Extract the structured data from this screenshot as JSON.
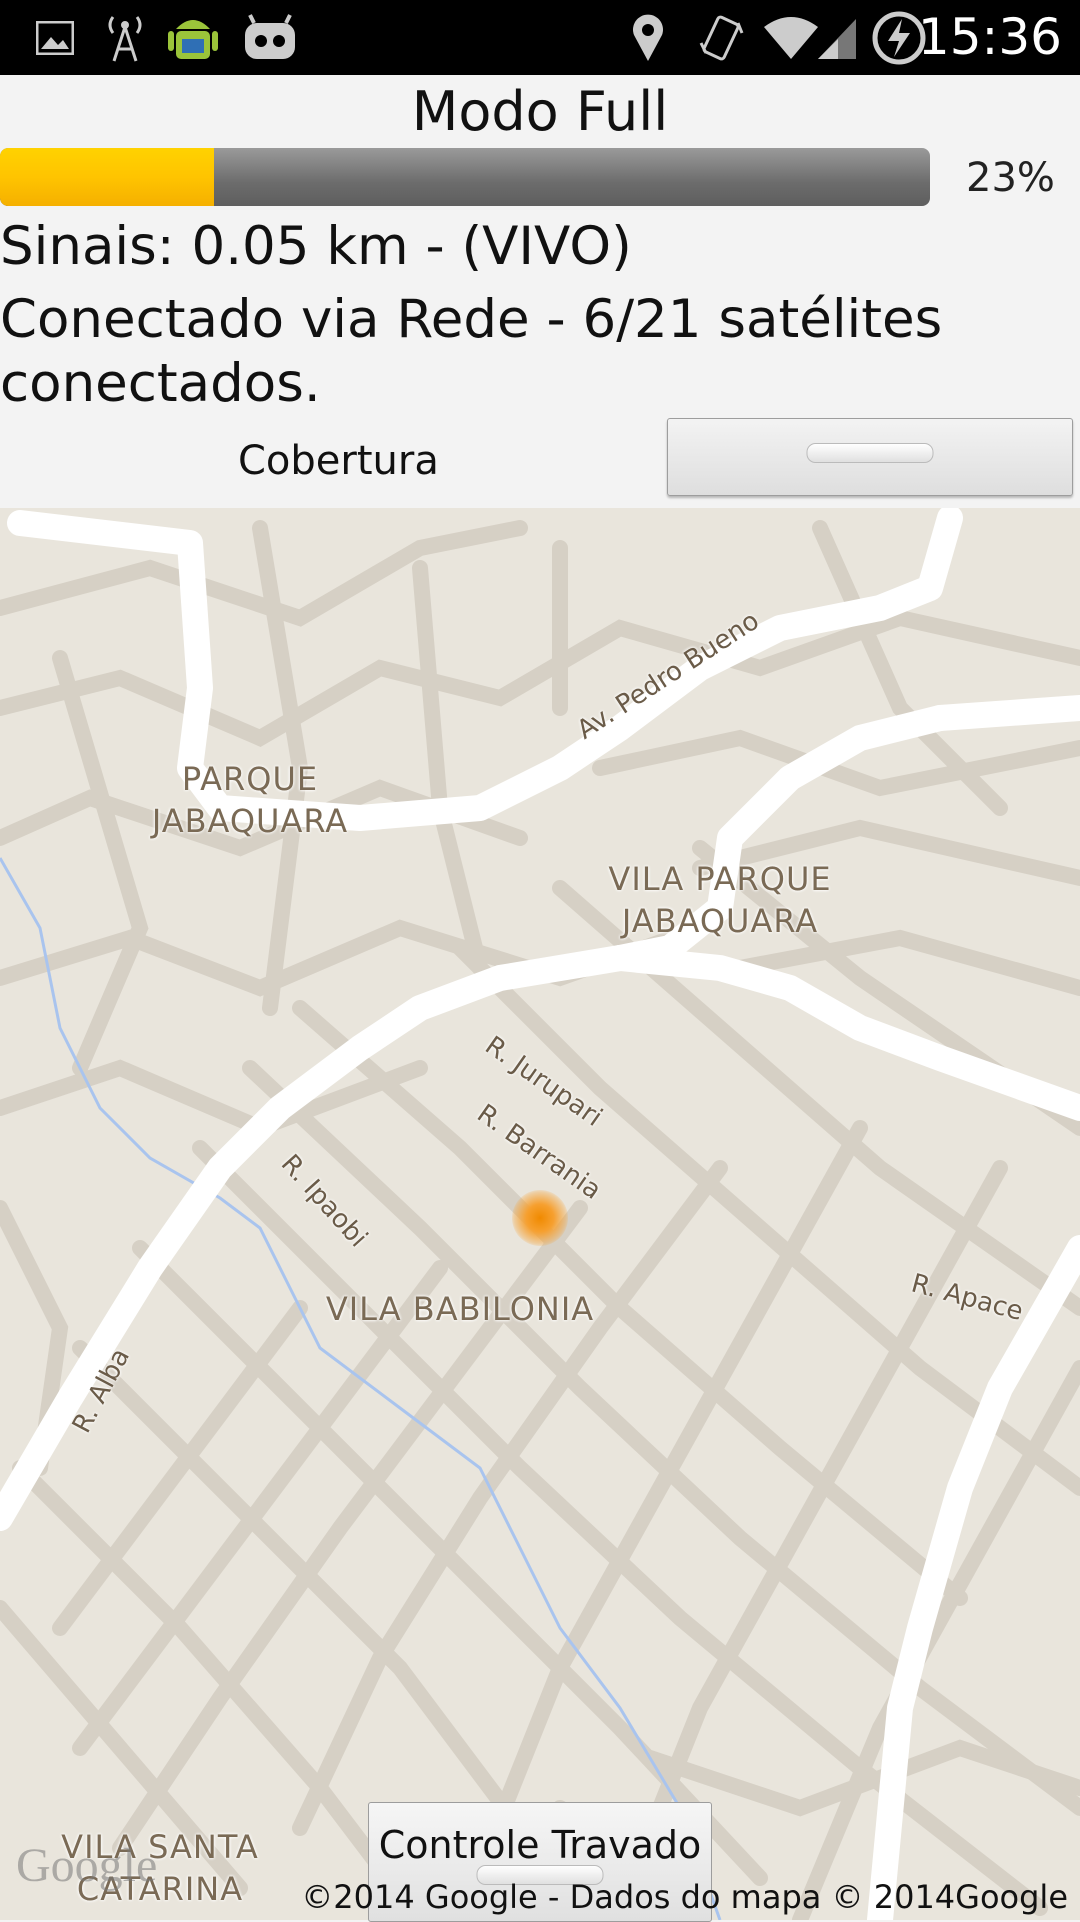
{
  "status_bar": {
    "time": "15:36",
    "icons": [
      "image-icon",
      "antenna-icon",
      "android-icon",
      "cyanogen-icon",
      "location-icon",
      "vibrate-icon",
      "wifi-icon",
      "signal-icon",
      "battery-charging-icon"
    ]
  },
  "header": {
    "title": "Modo Full",
    "progress": {
      "percent_value": 0.23,
      "label": "23%"
    },
    "signal_line": "Sinais: 0.05 km - (VIVO)",
    "connection_line": "Conectado via Rede - 6/21 satélites conectados.",
    "coverage_label": "Cobertura"
  },
  "map": {
    "areas": [
      {
        "text": "PARQUE JABAQUARA"
      },
      {
        "text": "VILA PARQUE JABAQUARA"
      },
      {
        "text": "VILA BABILONIA"
      },
      {
        "text": "VILA SANTA CATARINA"
      }
    ],
    "streets": [
      "Av. Pedro Bueno",
      "R. Jurupari",
      "R. Barrania",
      "R. Ipaobi",
      "R. Apace",
      "R. Alba"
    ],
    "locked_button": "Controle Travado",
    "logo": "Google",
    "copyright": "©2014 Google - Dados do mapa © 2014Google",
    "colors": {
      "land": "#e9e5dc",
      "road": "#ffffff",
      "minor_road": "#d6d0c5",
      "river": "#a9c4ee",
      "marker": "#f08a00"
    }
  }
}
